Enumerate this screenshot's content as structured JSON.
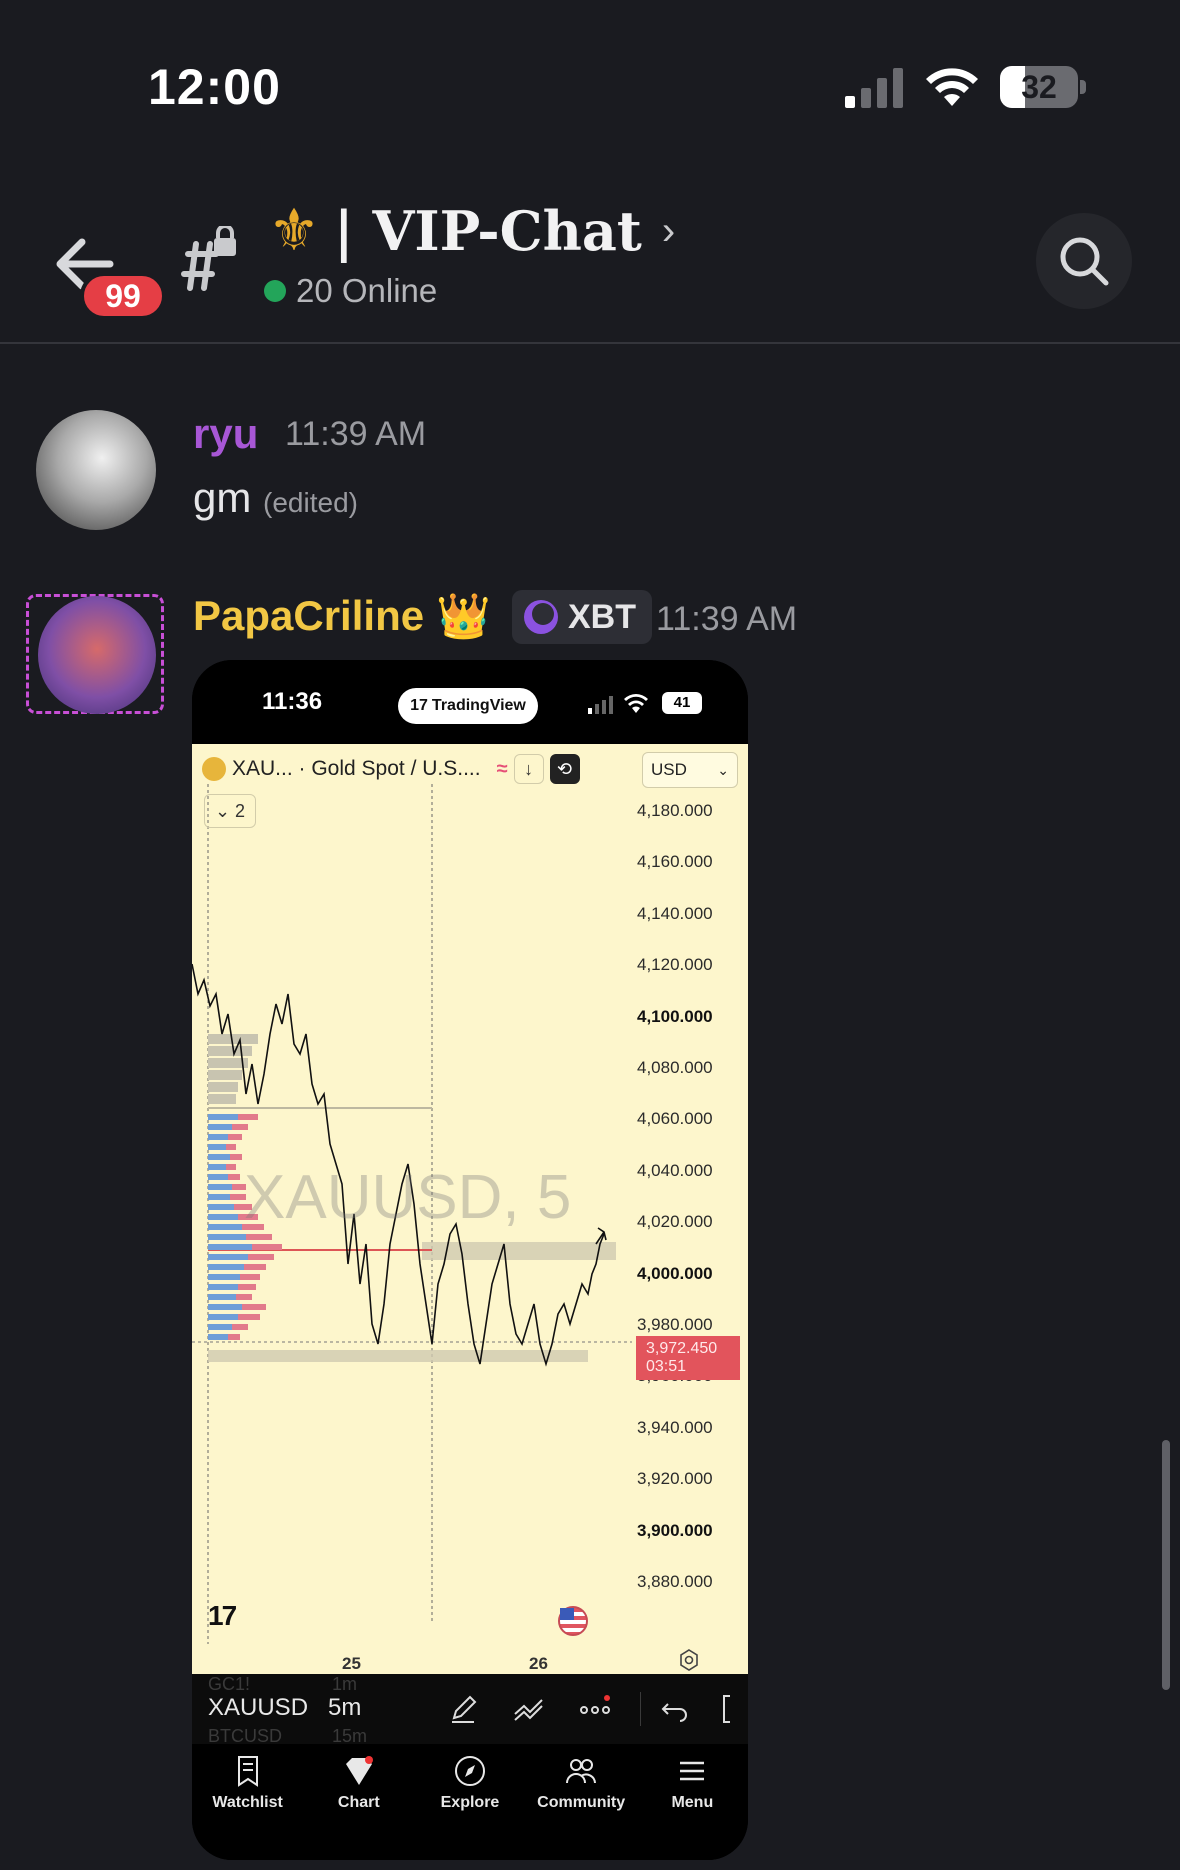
{
  "status_bar": {
    "time": "12:00",
    "battery": "32",
    "battery_percent": 32
  },
  "header": {
    "back_badge": "99",
    "channel_emoji": "⚜",
    "channel_name": "| VIP-Chat",
    "online": "20 Online"
  },
  "messages": [
    {
      "username": "ryu",
      "timestamp": "11:39 AM",
      "text": "gm",
      "edited": "(edited)"
    },
    {
      "username": "PapaCriline",
      "crown": "👑",
      "tag": "XBT",
      "timestamp": "11:39 AM",
      "attachment": {
        "status_time": "11:36",
        "app_pill": "TradingView",
        "app_pill_logo": "17",
        "battery": "41",
        "symbol": "XAU... · Gold Spot / U.S....",
        "currency": "USD",
        "collapse": "⌄ 2",
        "watermark": "XAUUSD, 5",
        "price_labels": [
          "4,180.000",
          "4,160.000",
          "4,140.000",
          "4,120.000",
          "4,100.000",
          "4,080.000",
          "4,060.000",
          "4,040.000",
          "4,020.000",
          "4,000.000",
          "3,980.000",
          "3,960.000",
          "3,940.000",
          "3,920.000",
          "3,900.000",
          "3,880.000"
        ],
        "last_price": "3,972.450",
        "countdown": "03:51",
        "date_labels": [
          "25",
          "26"
        ],
        "tv_mark": "17",
        "toolbar": {
          "symbol": "XAUUSD",
          "interval": "5m",
          "ghost_1": "GC1!",
          "ghost_2": "1m",
          "ghost_3": "BTCUSD",
          "ghost_4": "15m"
        },
        "nav": [
          "Watchlist",
          "Chart",
          "Explore",
          "Community",
          "Menu"
        ]
      }
    }
  ]
}
